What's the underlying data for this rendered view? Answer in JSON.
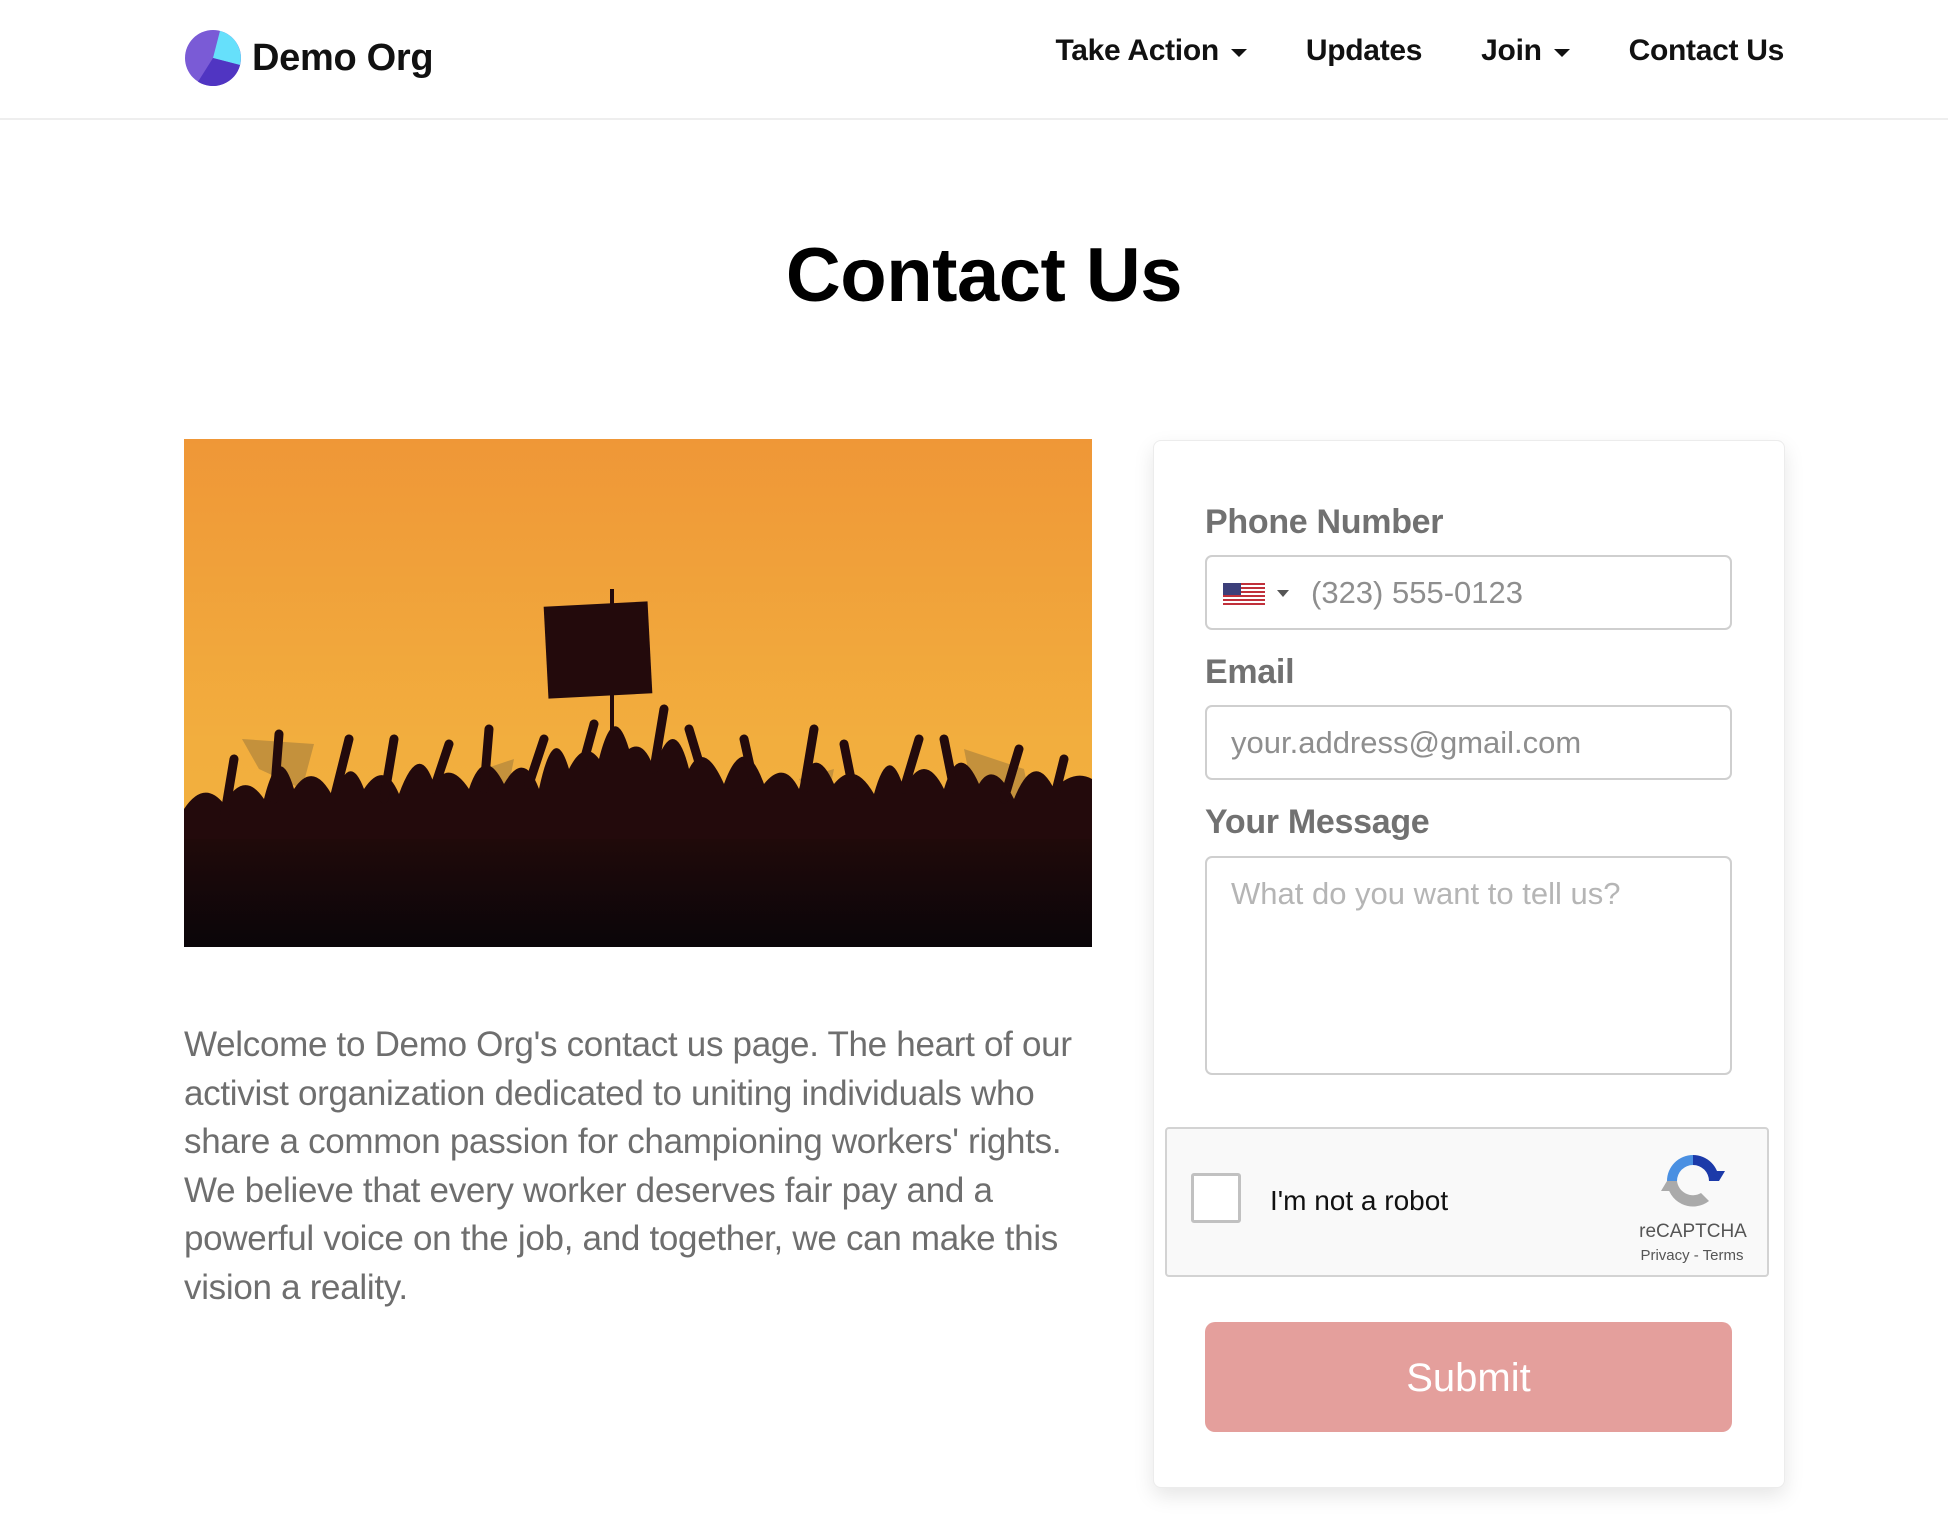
{
  "header": {
    "brand_name": "Demo Org",
    "logo_icon": "pie-logo-icon",
    "nav": [
      {
        "label": "Take Action",
        "has_dropdown": true
      },
      {
        "label": "Updates",
        "has_dropdown": false
      },
      {
        "label": "Join",
        "has_dropdown": true
      },
      {
        "label": "Contact Us",
        "has_dropdown": false
      }
    ]
  },
  "page": {
    "title": "Contact Us",
    "hero_image": "protest-crowd-silhouette",
    "intro": "Welcome to Demo Org's contact us page. The heart of our activist organization dedicated to uniting individuals who share a common passion for championing workers' rights. We believe that every worker deserves fair pay and a powerful voice on the job, and together, we can make this vision a reality."
  },
  "form": {
    "phone": {
      "label": "Phone Number",
      "country_flag": "us-flag-icon",
      "placeholder": "(323) 555-0123"
    },
    "email": {
      "label": "Email",
      "placeholder": "your.address@gmail.com"
    },
    "message": {
      "label": "Your Message",
      "placeholder": "What do you want to tell us?"
    },
    "captcha": {
      "label": "I'm not a robot",
      "brand": "reCAPTCHA",
      "links": "Privacy - Terms",
      "checked": false
    },
    "submit_label": "Submit",
    "submit_color": "#e49f9c"
  }
}
